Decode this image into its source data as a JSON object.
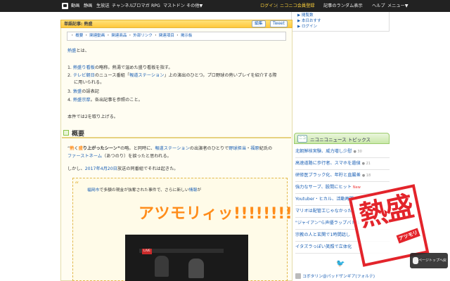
{
  "topbar": {
    "nav": [
      "動画",
      "静画",
      "生放送",
      "チャンネル",
      "ブロマガ",
      "RPG",
      "マストドン",
      "その他▼"
    ],
    "login": "ログイン",
    "sep": "|",
    "register": "ニコニコ会員登録",
    "random": "記事のランダム表示",
    "help": "ヘルプ",
    "menu": "メニュー▼"
  },
  "right_panel": {
    "line1": "▶ 閲覧数",
    "line2": "▶ 本日おすす",
    "line3": "▶ ログイン"
  },
  "article": {
    "category": "単語記事: 熱盛",
    "edit_label": "編集",
    "tweet_label": "Tweet",
    "subnav": [
      "概要",
      "関連動画",
      "関連商品",
      "外部リンク",
      "関連項目",
      "掲示板"
    ],
    "subnav_sep": "・",
    "intro_link": "熱盛",
    "intro_rest": "とは、",
    "items": [
      {
        "num": "1.",
        "link": "熱盛り",
        "mid": "",
        "link2": "看板",
        "rest": "の略称。熱湯で温めた盛り看板を指す。"
      },
      {
        "num": "2.",
        "link": "テレビ朝日",
        "mid": "のニュース番組「",
        "link2": "報道ステーション",
        "rest": "」上の演出のひとつ。プロ野球の熱いプレイを紹介する際"
      },
      {
        "num": "3.",
        "link": "敦盛",
        "mid": "の誤表記",
        "link2": "",
        "rest": ""
      },
      {
        "num": "4.",
        "link": "熱盛宗厚",
        "mid": "。各出記事を参照のこと。",
        "link2": "",
        "rest": ""
      }
    ],
    "item2_cont": "に用いられる。",
    "note": "本件では2を取り上げる。",
    "section_title": "概要",
    "p1_a": "“",
    "p1_hot": "熱",
    "p1_b": "く",
    "p1_moru": "盛",
    "p1_c": "り上がったシーン”",
    "p1_d": "の略。と同時に、",
    "p1_link1": "報道ステーション",
    "p1_e": "の出演者のひとりで",
    "p1_link2": "野球担当",
    "p1_f": "・",
    "p1_link3": "福原",
    "p1_g": "紀氏の",
    "p1_line2_link": "ファーストネーム",
    "p1_line2": "（あつのり）を捩ったと思われる。",
    "p2_a": "しかし、",
    "p2_link": "2017年4月20日",
    "p2_b": "放送の同番組でそれは起きた。",
    "quote_link": "福岡市",
    "quote_mid": "で多額の現金が強奪された事件で、さらに新しい",
    "quote_link2": "情報",
    "quote_end": "が",
    "big_text": "アツモリィッ!!!!!!!!!",
    "video_logo": "LIVE"
  },
  "news": {
    "header": "ニコニコニュース トピックス",
    "header_icon": "ニコ",
    "items": [
      {
        "title": "北朝鮮核実験、威力増し少慰",
        "count": "● 30",
        "is_new": false
      },
      {
        "title": "高速道路に歩行者、スマホを遺偵",
        "count": "● 21",
        "is_new": false
      },
      {
        "title": "研修医ブラック化、年貯と直腸差",
        "count": "● 18",
        "is_new": false
      },
      {
        "title": "強力なサーブ、股間にヒット",
        "count": "",
        "is_new": true,
        "new_label": "New"
      },
      {
        "title": "Youtuber・ヒカル、活動再開",
        "count": "",
        "is_new": false
      },
      {
        "title": "マリオは配管工じゃなかった",
        "count": "",
        "is_new": false
      },
      {
        "title": "\"ジャイアン\"ら声優ラップバトル",
        "count": "",
        "is_new": false
      },
      {
        "title": "宗教の人と玄関で1時間話し",
        "count": "",
        "is_new": false
      },
      {
        "title": "イタズラっぽい笑顔で立体化",
        "count": "",
        "is_new": false
      }
    ],
    "twitter_user": "コボタリン@パッドザンギア(フォルテ)"
  },
  "stamp": {
    "big": "熱盛",
    "small": "アツモリ",
    "color": "#e3242b"
  },
  "pagetop_label": "ページトップへ戻る",
  "colors": {
    "topbar": "#222222",
    "accent_orange": "#ff8c1a",
    "link": "#1a5fb4",
    "title_bar": "#ffc83d"
  }
}
